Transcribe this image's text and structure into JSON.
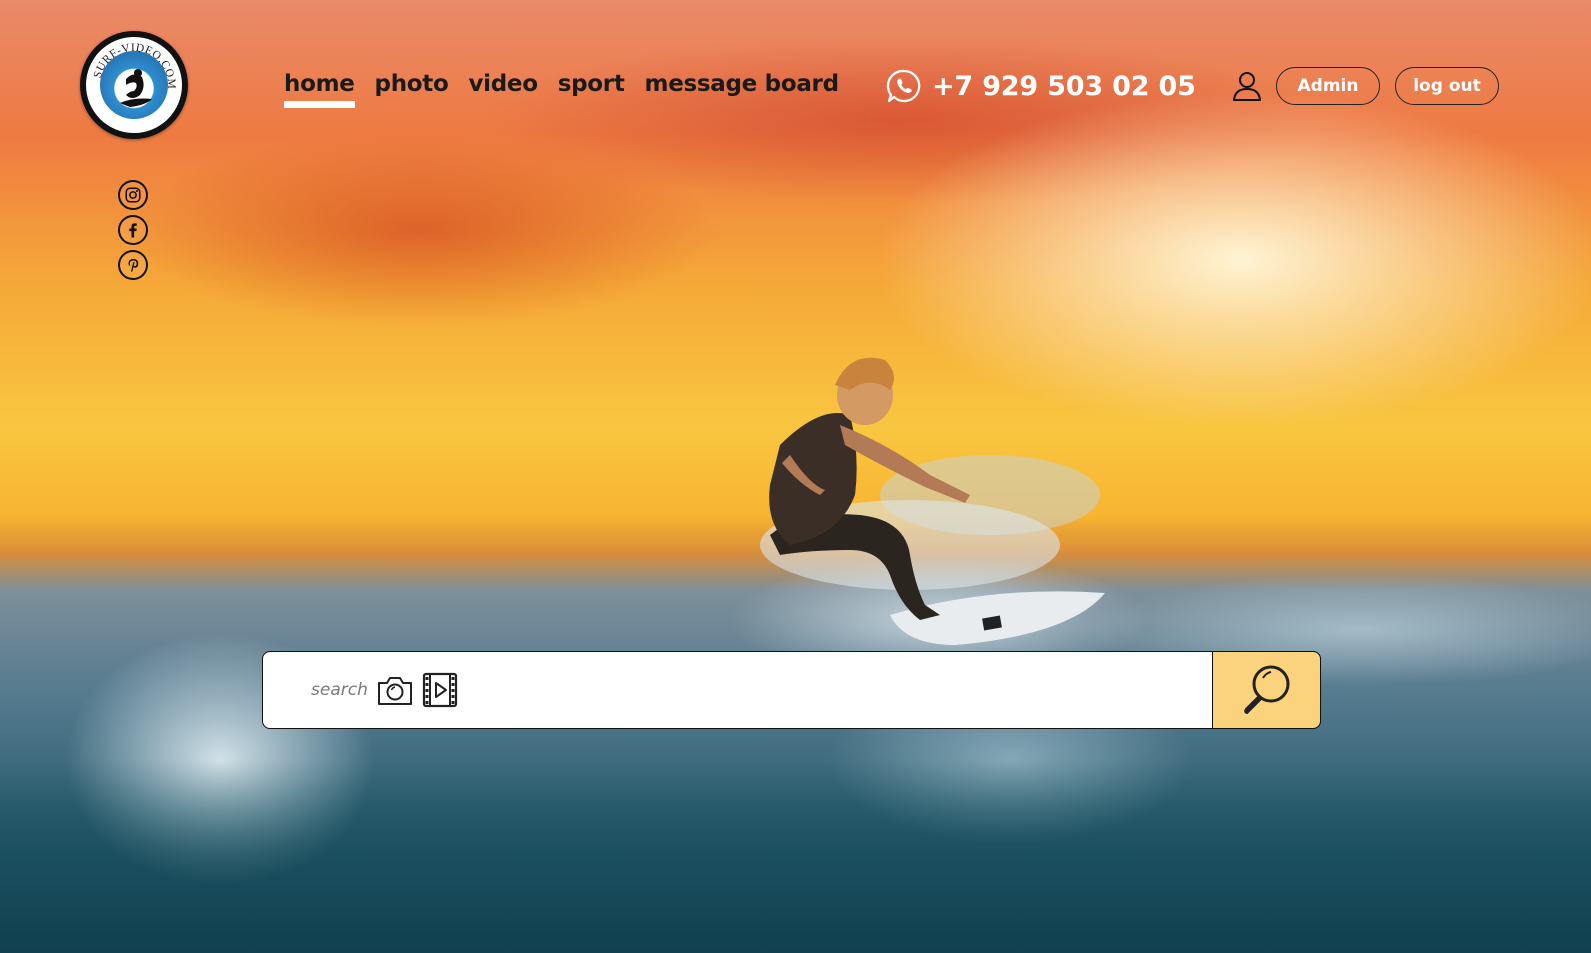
{
  "logo": {
    "text": "SURF-VIDEO.COM",
    "icon": "surfer-logo-icon"
  },
  "social": [
    {
      "name": "instagram",
      "icon": "instagram-icon"
    },
    {
      "name": "facebook",
      "icon": "facebook-icon"
    },
    {
      "name": "pinterest",
      "icon": "pinterest-icon"
    }
  ],
  "nav": {
    "items": [
      {
        "label": "home",
        "active": true
      },
      {
        "label": "photo"
      },
      {
        "label": "video"
      },
      {
        "label": "sport"
      },
      {
        "label": "message board"
      }
    ]
  },
  "contact": {
    "phone": "+7 929 503 02 05",
    "icon": "whatsapp-icon"
  },
  "user": {
    "icon": "user-icon",
    "admin_label": "Admin",
    "logout_label": "log out"
  },
  "search": {
    "placeholder": "search",
    "photo_icon": "camera-icon",
    "video_icon": "film-icon",
    "button_icon": "magnifier-icon",
    "button_color": "#fbd37d"
  },
  "colors": {
    "nav_text": "#1a1a1a",
    "header_text": "#ffffff",
    "accent": "#fbd37d"
  }
}
